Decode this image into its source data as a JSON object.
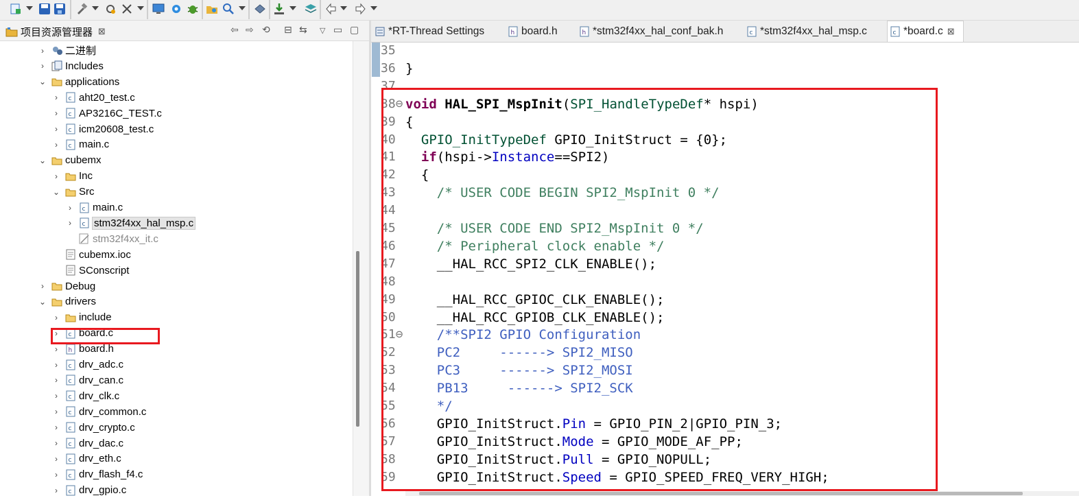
{
  "toolbar": {
    "icons": [
      "new-icon",
      "save-icon",
      "save-all-icon",
      "build-icon",
      "tools-icon",
      "debug-tools-icon",
      "monitor-icon",
      "settings-icon",
      "bug-icon",
      "open-folder-icon",
      "search-icon",
      "package-icon",
      "download-icon",
      "layers-icon",
      "back-icon",
      "forward-icon"
    ]
  },
  "project_explorer": {
    "title": "项目资源管理器",
    "close_glyph": "⊠",
    "tree": [
      {
        "label": "二进制",
        "depth": 0,
        "expand": "›",
        "icon": "binary-icon"
      },
      {
        "label": "Includes",
        "depth": 0,
        "expand": "›",
        "icon": "includes-icon"
      },
      {
        "label": "applications",
        "depth": 0,
        "expand": "⌄",
        "icon": "folder-icon"
      },
      {
        "label": "aht20_test.c",
        "depth": 1,
        "expand": "›",
        "icon": "c-file-icon"
      },
      {
        "label": "AP3216C_TEST.c",
        "depth": 1,
        "expand": "›",
        "icon": "c-file-icon"
      },
      {
        "label": "icm20608_test.c",
        "depth": 1,
        "expand": "›",
        "icon": "c-file-icon"
      },
      {
        "label": "main.c",
        "depth": 1,
        "expand": "›",
        "icon": "c-file-icon"
      },
      {
        "label": "cubemx",
        "depth": 0,
        "expand": "⌄",
        "icon": "folder-icon"
      },
      {
        "label": "Inc",
        "depth": 1,
        "expand": "›",
        "icon": "folder-icon"
      },
      {
        "label": "Src",
        "depth": 1,
        "expand": "⌄",
        "icon": "folder-icon"
      },
      {
        "label": "main.c",
        "depth": 2,
        "expand": "›",
        "icon": "c-file-icon"
      },
      {
        "label": "stm32f4xx_hal_msp.c",
        "depth": 2,
        "expand": "›",
        "icon": "c-file-icon",
        "selected": true
      },
      {
        "label": "stm32f4xx_it.c",
        "depth": 2,
        "expand": "",
        "icon": "excluded-c-file-icon",
        "dim": true
      },
      {
        "label": "cubemx.ioc",
        "depth": 1,
        "expand": "",
        "icon": "file-icon"
      },
      {
        "label": "SConscript",
        "depth": 1,
        "expand": "",
        "icon": "file-icon"
      },
      {
        "label": "Debug",
        "depth": 0,
        "expand": "›",
        "icon": "folder-icon"
      },
      {
        "label": "drivers",
        "depth": 0,
        "expand": "⌄",
        "icon": "folder-icon"
      },
      {
        "label": "include",
        "depth": 1,
        "expand": "›",
        "icon": "folder-icon"
      },
      {
        "label": "board.c",
        "depth": 1,
        "expand": "›",
        "icon": "c-file-icon"
      },
      {
        "label": "board.h",
        "depth": 1,
        "expand": "›",
        "icon": "h-file-icon"
      },
      {
        "label": "drv_adc.c",
        "depth": 1,
        "expand": "›",
        "icon": "c-file-icon"
      },
      {
        "label": "drv_can.c",
        "depth": 1,
        "expand": "›",
        "icon": "c-file-icon"
      },
      {
        "label": "drv_clk.c",
        "depth": 1,
        "expand": "›",
        "icon": "c-file-icon"
      },
      {
        "label": "drv_common.c",
        "depth": 1,
        "expand": "›",
        "icon": "c-file-icon"
      },
      {
        "label": "drv_crypto.c",
        "depth": 1,
        "expand": "›",
        "icon": "c-file-icon"
      },
      {
        "label": "drv_dac.c",
        "depth": 1,
        "expand": "›",
        "icon": "c-file-icon"
      },
      {
        "label": "drv_eth.c",
        "depth": 1,
        "expand": "›",
        "icon": "c-file-icon"
      },
      {
        "label": "drv_flash_f4.c",
        "depth": 1,
        "expand": "›",
        "icon": "c-file-icon"
      },
      {
        "label": "drv_gpio.c",
        "depth": 1,
        "expand": "›",
        "icon": "c-file-icon"
      }
    ]
  },
  "editor": {
    "tabs": [
      {
        "label": "*RT-Thread Settings",
        "icon": "settings-file-icon"
      },
      {
        "label": "board.h",
        "icon": "h-file-icon"
      },
      {
        "label": "*stm32f4xx_hal_conf_bak.h",
        "icon": "h-file-icon"
      },
      {
        "label": "*stm32f4xx_hal_msp.c",
        "icon": "c-file-icon"
      },
      {
        "label": "*board.c",
        "icon": "c-file-icon",
        "active": true,
        "close": "⊠"
      }
    ],
    "lines": [
      {
        "n": "35",
        "text": ""
      },
      {
        "n": "36",
        "text": "}"
      },
      {
        "n": "37",
        "text": ""
      },
      {
        "n": "38⊖",
        "text": "void HAL_SPI_MspInit(SPI_HandleTypeDef* hspi)"
      },
      {
        "n": "39",
        "text": "{"
      },
      {
        "n": "40",
        "text": "  GPIO_InitTypeDef GPIO_InitStruct = {0};"
      },
      {
        "n": "41",
        "text": "  if(hspi->Instance==SPI2)"
      },
      {
        "n": "42",
        "text": "  {"
      },
      {
        "n": "43",
        "text": "    /* USER CODE BEGIN SPI2_MspInit 0 */"
      },
      {
        "n": "44",
        "text": ""
      },
      {
        "n": "45",
        "text": "    /* USER CODE END SPI2_MspInit 0 */"
      },
      {
        "n": "46",
        "text": "    /* Peripheral clock enable */"
      },
      {
        "n": "47",
        "text": "    __HAL_RCC_SPI2_CLK_ENABLE();"
      },
      {
        "n": "48",
        "text": ""
      },
      {
        "n": "49",
        "text": "    __HAL_RCC_GPIOC_CLK_ENABLE();"
      },
      {
        "n": "50",
        "text": "    __HAL_RCC_GPIOB_CLK_ENABLE();"
      },
      {
        "n": "51⊖",
        "text": "    /**SPI2 GPIO Configuration"
      },
      {
        "n": "52",
        "text": "    PC2     ------> SPI2_MISO"
      },
      {
        "n": "53",
        "text": "    PC3     ------> SPI2_MOSI"
      },
      {
        "n": "54",
        "text": "    PB13     ------> SPI2_SCK"
      },
      {
        "n": "55",
        "text": "    */"
      },
      {
        "n": "56",
        "text": "    GPIO_InitStruct.Pin = GPIO_PIN_2|GPIO_PIN_3;"
      },
      {
        "n": "57",
        "text": "    GPIO_InitStruct.Mode = GPIO_MODE_AF_PP;"
      },
      {
        "n": "58",
        "text": "    GPIO_InitStruct.Pull = GPIO_NOPULL;"
      },
      {
        "n": "59",
        "text": "    GPIO_InitStruct.Speed = GPIO_SPEED_FREQ_VERY_HIGH;"
      }
    ]
  },
  "colors": {
    "highlight_box": "#e8191f",
    "keyword": "#7f0055",
    "comment": "#3f7f5f",
    "doc_comment": "#3f5fbf",
    "field": "#0000c0",
    "type": "#005032"
  }
}
